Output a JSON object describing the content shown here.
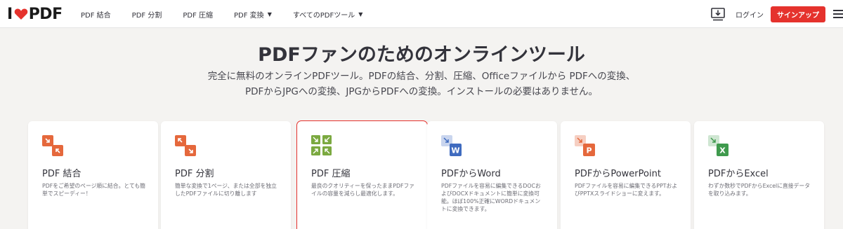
{
  "header": {
    "logo": {
      "left": "I",
      "right": "PDF"
    },
    "nav": [
      {
        "label": "PDF 結合",
        "dropdown": false
      },
      {
        "label": "PDF 分割",
        "dropdown": false
      },
      {
        "label": "PDF 圧縮",
        "dropdown": false
      },
      {
        "label": "PDF 変換",
        "dropdown": true
      },
      {
        "label": "すべてのPDFツール",
        "dropdown": true
      }
    ],
    "download_icon": "desktop-download-icon",
    "login": "ログイン",
    "signup": "サインアップ",
    "menu_icon": "hamburger-menu-icon"
  },
  "hero": {
    "title": "PDFファンのためのオンラインツール",
    "subtitle_line1": "完全に無料のオンラインPDFツール。PDFの結合、分割、圧縮、Officeファイルから PDFへの変換、",
    "subtitle_line2": "PDFからJPGへの変換、JPGからPDFへの変換。インストールの必要はありません。"
  },
  "tools": [
    {
      "title": "PDF 結合",
      "desc": "PDFをご希望のページ順に結合。とても簡単でスピーディー！",
      "icon": "merge-icon",
      "color": "#e5683c"
    },
    {
      "title": "PDF 分割",
      "desc": "簡単な変換で1ページ、または全部を独立したPDFファイルに切り離します",
      "icon": "split-icon",
      "color": "#e5683c"
    },
    {
      "title": "PDF 圧縮",
      "desc": "最良のクオリティーを保ったままPDFファイルの容量を減らし最適化します。",
      "icon": "compress-icon",
      "color": "#7ba940",
      "selected": true
    },
    {
      "title": "PDFからWord",
      "desc": "PDFファイルを容易に編集できるDOCおよびDOCXドキュメントに簡単に変換可能。ほぼ100%正確にWORDドキュメントに変換できます。",
      "icon": "word-icon",
      "color": "#3f6bbf"
    },
    {
      "title": "PDFからPowerPoint",
      "desc": "PDFファイルを容易に編集できるPPTおよびPPTXスライドショーに変えます。",
      "icon": "powerpoint-icon",
      "color": "#e5683c"
    },
    {
      "title": "PDFからExcel",
      "desc": "わずか数秒でPDFからExcelに直接データを取り込みます。",
      "icon": "excel-icon",
      "color": "#3f9a4d"
    }
  ],
  "colors": {
    "brand_red": "#e5322d",
    "background": "#f4f3f1"
  }
}
